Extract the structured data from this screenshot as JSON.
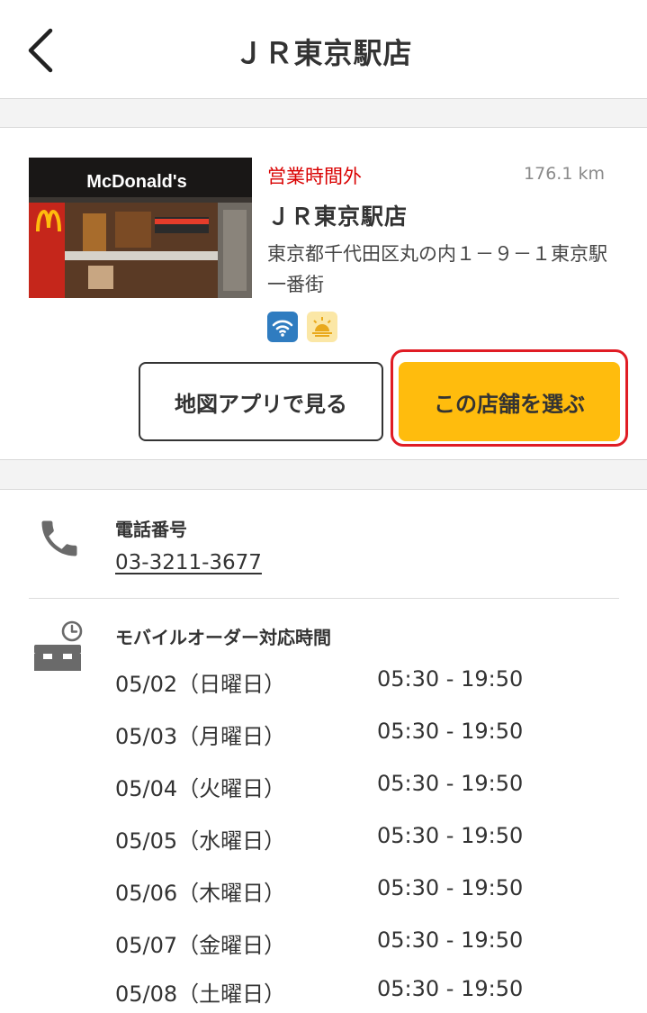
{
  "header": {
    "title": "ＪＲ東京駅店"
  },
  "store": {
    "status": "営業時間外",
    "distance": "176.1 km",
    "name": "ＪＲ東京駅店",
    "address": "東京都千代田区丸の内１－９－１東京駅一番街",
    "photo_sign": "McDonald's",
    "badges": [
      "wifi-icon",
      "morning-menu-icon"
    ]
  },
  "buttons": {
    "map": "地図アプリで見る",
    "select": "この店舗を選ぶ"
  },
  "phone": {
    "label": "電話番号",
    "number": "03-3211-3677"
  },
  "hours": {
    "label": "モバイルオーダー対応時間",
    "rows": [
      {
        "day": "05/02（日曜日）",
        "time": "05:30 - 19:50"
      },
      {
        "day": "05/03（月曜日）",
        "time": "05:30 - 19:50"
      },
      {
        "day": "05/04（火曜日）",
        "time": "05:30 - 19:50"
      },
      {
        "day": "05/05（水曜日）",
        "time": "05:30 - 19:50"
      },
      {
        "day": "05/06（木曜日）",
        "time": "05:30 - 19:50"
      },
      {
        "day": "05/07（金曜日）",
        "time": "05:30 - 19:50"
      },
      {
        "day": "05/08（土曜日）",
        "time": "05:30 - 19:50"
      }
    ]
  },
  "colors": {
    "accent": "#ffbc0d",
    "status": "#d90000",
    "highlight": "#e01c24"
  }
}
